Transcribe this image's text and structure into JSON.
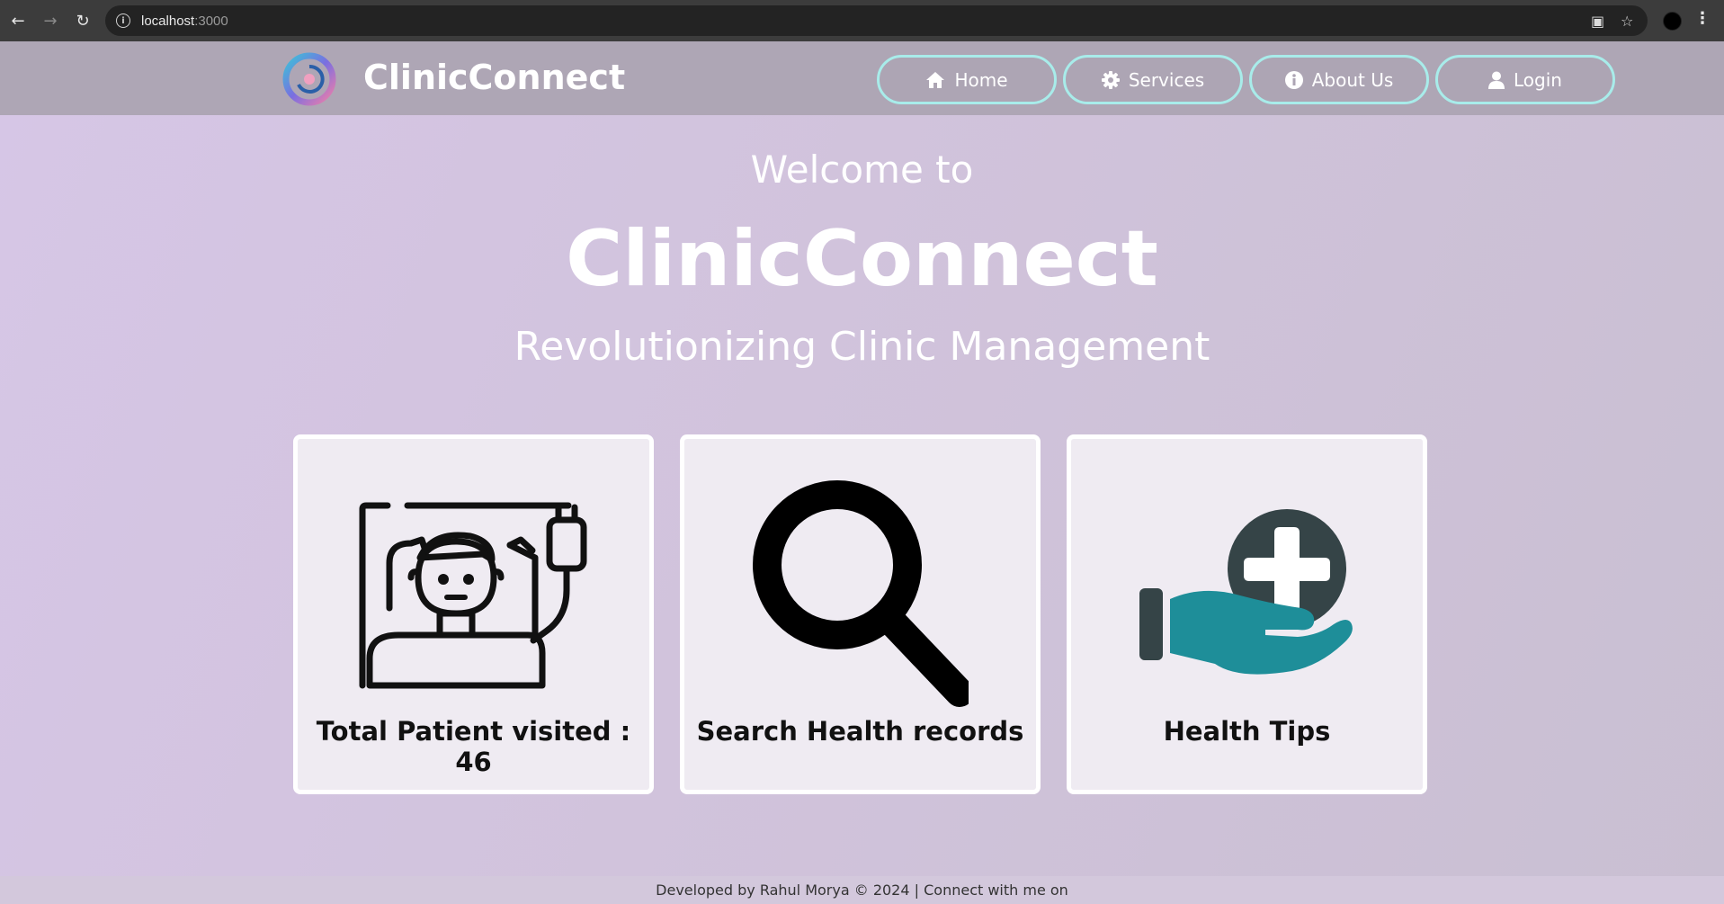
{
  "browser": {
    "url_host": "localhost",
    "url_port": ":3000",
    "back_icon": "back-arrow-icon",
    "forward_icon": "forward-arrow-icon",
    "reload_icon": "reload-icon"
  },
  "header": {
    "brand": "ClinicConnect",
    "nav": [
      {
        "label": "Home",
        "icon": "home-icon"
      },
      {
        "label": "Services",
        "icon": "gear-icon"
      },
      {
        "label": "About Us",
        "icon": "info-icon"
      },
      {
        "label": "Login",
        "icon": "user-icon"
      }
    ]
  },
  "hero": {
    "welcome": "Welcome to",
    "title": "ClinicConnect",
    "subtitle": "Revolutionizing Clinic Management"
  },
  "cards": [
    {
      "label": "Total Patient visited : 46",
      "icon": "patient-bed-icon"
    },
    {
      "label": "Search Health records",
      "icon": "search-icon"
    },
    {
      "label": "Health Tips",
      "icon": "health-hand-icon"
    }
  ],
  "footer": {
    "text": "Developed by Rahul Morya © 2024 | Connect with me on"
  },
  "colors": {
    "nav_border": "#a8ecea",
    "navbar_bg": "#aea6b5",
    "card_bg": "#efebf2",
    "teal": "#1e8e99",
    "dark_slate": "#354447"
  }
}
